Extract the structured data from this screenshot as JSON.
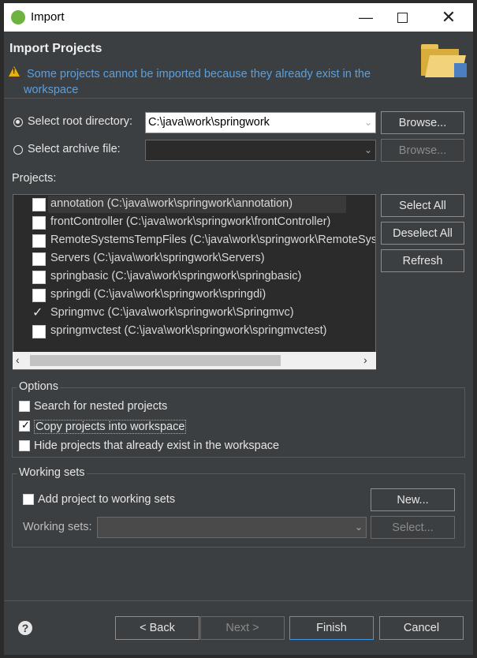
{
  "window": {
    "title": "Import",
    "min_icon": "minimize-icon",
    "max_icon": "maximize-icon",
    "close_icon": "close-icon"
  },
  "header": {
    "title": "Import Projects",
    "warning": "Some projects cannot be imported because they already exist in the workspace"
  },
  "source": {
    "root_label": "Select root directory:",
    "root_value": "C:\\java\\work\\springwork",
    "archive_label": "Select archive file:",
    "archive_value": "",
    "browse_label": "Browse...",
    "browse2_label": "Browse..."
  },
  "projects": {
    "label": "Projects:",
    "items": [
      {
        "text": "annotation (C:\\java\\work\\springwork\\annotation)",
        "checked": false,
        "highlight": true
      },
      {
        "text": "frontController (C:\\java\\work\\springwork\\frontController)",
        "checked": false
      },
      {
        "text": "RemoteSystemsTempFiles (C:\\java\\work\\springwork\\RemoteSystemsTempFiles)",
        "checked": false
      },
      {
        "text": "Servers (C:\\java\\work\\springwork\\Servers)",
        "checked": false
      },
      {
        "text": "springbasic (C:\\java\\work\\springwork\\springbasic)",
        "checked": false
      },
      {
        "text": "springdi (C:\\java\\work\\springwork\\springdi)",
        "checked": false
      },
      {
        "text": "Springmvc (C:\\java\\work\\springwork\\Springmvc)",
        "checked": true
      },
      {
        "text": "springmvctest (C:\\java\\work\\springwork\\springmvctest)",
        "checked": false
      }
    ],
    "select_all": "Select All",
    "deselect_all": "Deselect All",
    "refresh": "Refresh"
  },
  "options": {
    "title": "Options",
    "nested": "Search for nested projects",
    "copy": "Copy projects into workspace",
    "hide": "Hide projects that already exist in the workspace"
  },
  "working_sets": {
    "title": "Working sets",
    "add_label": "Add project to working sets",
    "new_label": "New...",
    "sets_label": "Working sets:",
    "select_label": "Select..."
  },
  "footer": {
    "back": "< Back",
    "next": "Next >",
    "finish": "Finish",
    "cancel": "Cancel",
    "help_icon": "help-icon"
  }
}
